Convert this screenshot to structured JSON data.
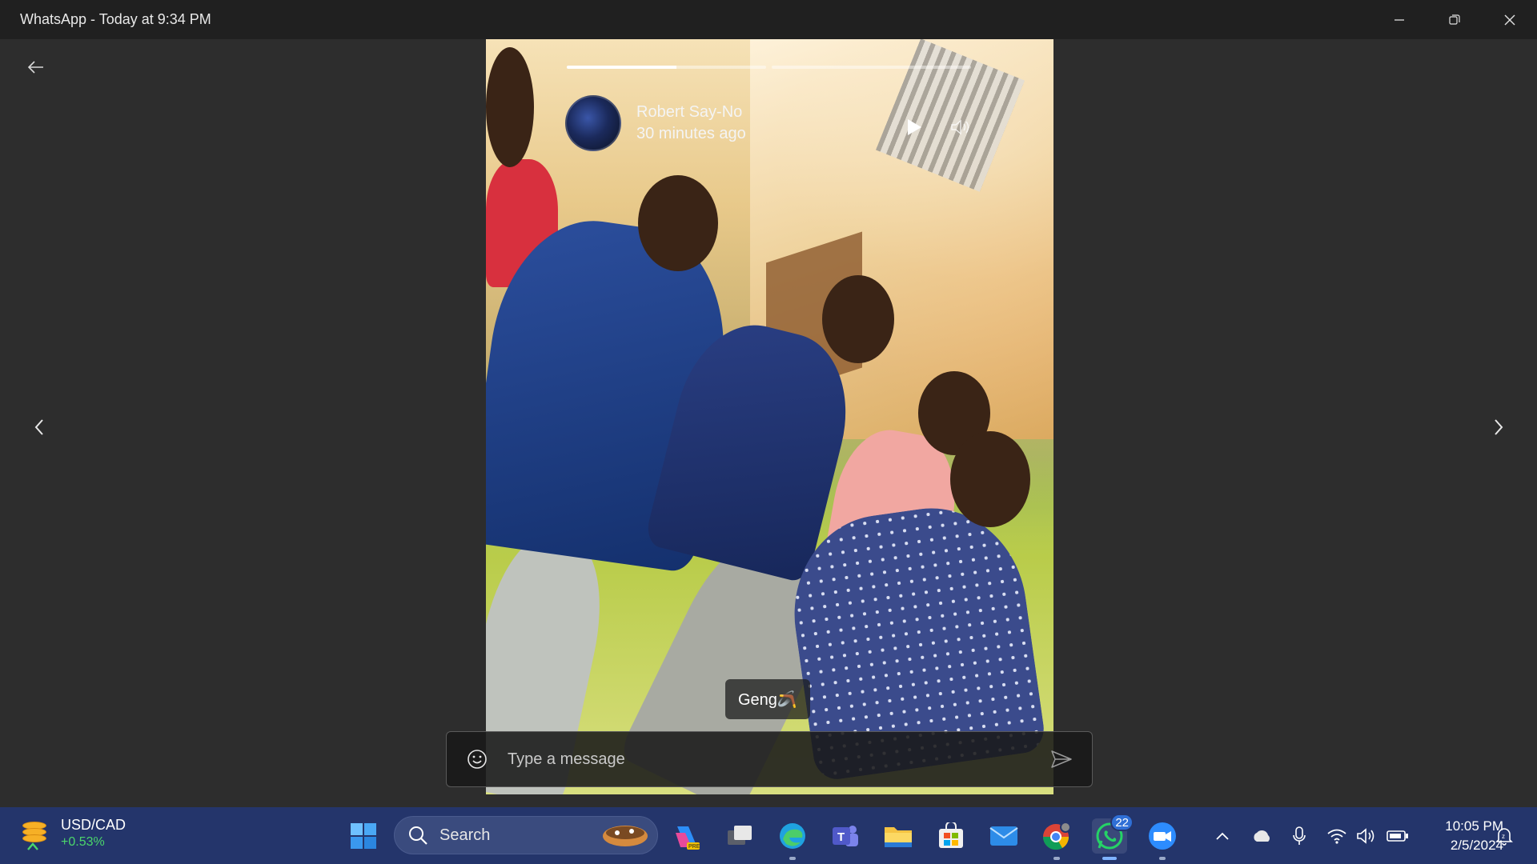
{
  "window": {
    "title": "WhatsApp - Today at 9:34 PM"
  },
  "status": {
    "contact_name": "Robert Say-No",
    "posted_ago": "30 minutes ago",
    "caption": "Geng🪃",
    "progress": {
      "segments": 2,
      "current_segment": 1,
      "current_fraction": 0.55
    }
  },
  "reply": {
    "placeholder": "Type a message"
  },
  "taskbar": {
    "widget": {
      "pair": "USD/CAD",
      "change": "+0.53%"
    },
    "search_label": "Search",
    "whatsapp_badge": "22",
    "clock": {
      "time": "10:05 PM",
      "date": "2/5/2024"
    }
  },
  "colors": {
    "titlebar": "#202020",
    "viewer_bg": "#2d2d2d",
    "taskbar": "#24356b",
    "widget_positive": "#4bd66b",
    "whatsapp_green": "#25d366",
    "badge_blue": "#2f6fd6"
  },
  "icons": {
    "back": "arrow-left-icon",
    "prev": "chevron-left-icon",
    "next": "chevron-right-icon",
    "play": "play-icon",
    "volume": "volume-icon",
    "emoji": "smiley-icon",
    "send": "send-icon"
  }
}
